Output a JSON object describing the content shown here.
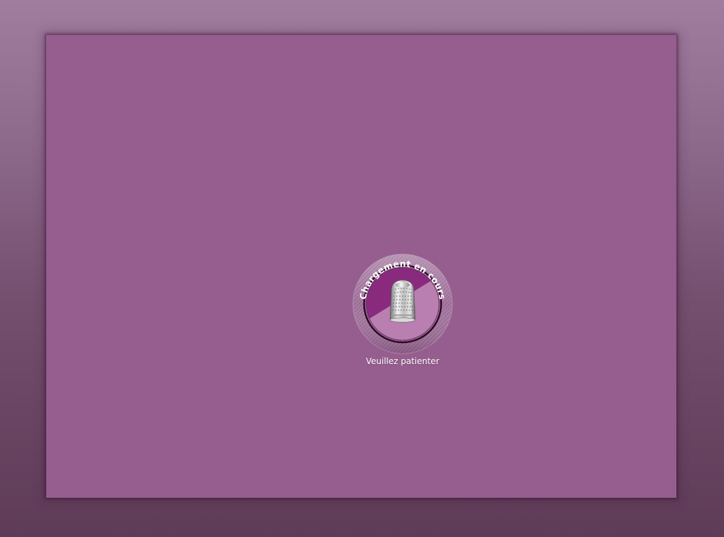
{
  "loader": {
    "ring_text": "Chargement en cours",
    "icon": "thimble-icon",
    "wait_label": "Veuillez patienter"
  },
  "colors": {
    "page_background_top": "#a07c9f",
    "page_background_bottom": "#5e3b57",
    "stage_background": "#955e8e",
    "disc_dark": "#8a2a7e",
    "disc_light": "#b97fb0",
    "ring": "#9a6a94",
    "text": "#ffffff"
  }
}
